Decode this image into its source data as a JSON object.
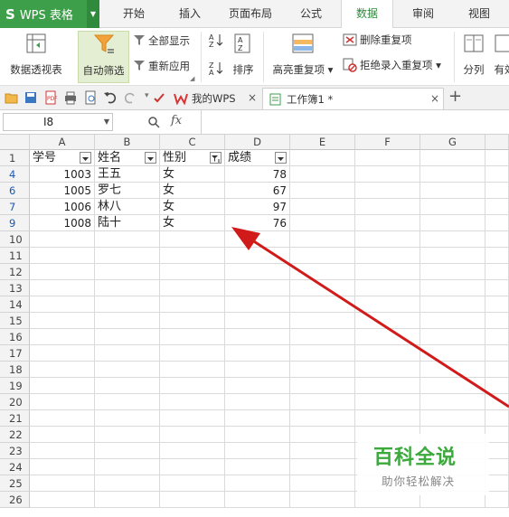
{
  "app": {
    "logo": "S",
    "name": "WPS 表格"
  },
  "menu": {
    "tabs": [
      "开始",
      "插入",
      "页面布局",
      "公式",
      "数据",
      "审阅",
      "视图"
    ],
    "active": "数据"
  },
  "ribbon": {
    "pivot": "数据透视表",
    "autofilter": "自动筛选",
    "show_all": "全部显示",
    "reapply": "重新应用",
    "sort": "排序",
    "highlight_dup": "高亮重复项",
    "remove_dup": "删除重复项",
    "reject_dup": "拒绝录入重复项",
    "split": "分列",
    "valid": "有效"
  },
  "docbar": {
    "tabs": [
      {
        "label": "我的WPS",
        "active": false
      },
      {
        "label": "工作簿1 *",
        "active": true
      }
    ],
    "new_tab": "+"
  },
  "formula": {
    "cell_ref": "I8",
    "fx": "fx",
    "content": ""
  },
  "sheet": {
    "columns": [
      "A",
      "B",
      "C",
      "D",
      "E",
      "F",
      "G"
    ],
    "row_numbers": [
      "1",
      "4",
      "6",
      "7",
      "9",
      "10",
      "11",
      "12",
      "13",
      "14",
      "15",
      "16",
      "17",
      "18",
      "19",
      "20",
      "21",
      "22",
      "23",
      "24",
      "25",
      "26"
    ],
    "header_row": [
      "学号",
      "姓名",
      "性别",
      "成绩"
    ],
    "rows": [
      [
        "1003",
        "王五",
        "女",
        "78"
      ],
      [
        "1005",
        "罗七",
        "女",
        "67"
      ],
      [
        "1006",
        "林八",
        "女",
        "97"
      ],
      [
        "1008",
        "陆十",
        "女",
        "76"
      ]
    ],
    "active_filter_column": "C"
  },
  "watermark": {
    "title": "百科全说",
    "subtitle": "助你轻松解决"
  },
  "colors": {
    "brand_green": "#3e9f4a",
    "filtered_row": "#1c58b8",
    "annotation_arrow": "#d11a1a"
  }
}
